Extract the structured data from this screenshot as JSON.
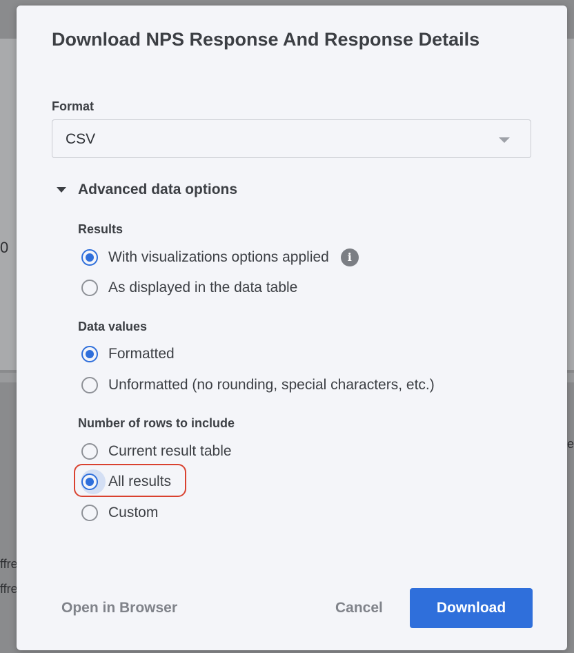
{
  "background": {
    "fragment_zero": "0",
    "fragment_e": "e",
    "fragment_ffre_1": "ffre",
    "fragment_ffre_2": "ffre"
  },
  "dialog": {
    "title": "Download NPS Response And Response Details",
    "format": {
      "label": "Format",
      "value": "CSV"
    },
    "advanced": {
      "toggle_label": "Advanced data options",
      "results": {
        "label": "Results",
        "options": [
          {
            "label": "With visualizations options applied",
            "selected": true
          },
          {
            "label": "As displayed in the data table",
            "selected": false
          }
        ]
      },
      "data_values": {
        "label": "Data values",
        "options": [
          {
            "label": "Formatted",
            "selected": true
          },
          {
            "label": "Unformatted (no rounding, special characters, etc.)",
            "selected": false
          }
        ]
      },
      "rows": {
        "label": "Number of rows to include",
        "options": [
          {
            "label": "Current result table",
            "selected": false
          },
          {
            "label": "All results",
            "selected": true
          },
          {
            "label": "Custom",
            "selected": false
          }
        ]
      }
    },
    "footer": {
      "open_in_browser": "Open in Browser",
      "cancel": "Cancel",
      "download": "Download"
    }
  },
  "colors": {
    "accent": "#2f6fdb",
    "highlight_outline": "#d9412f"
  }
}
